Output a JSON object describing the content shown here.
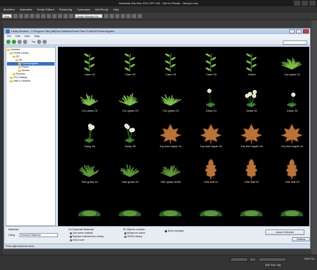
{
  "app": {
    "title": "Autodesk 3ds Max 2010 SP2 x64 - Not for Resale - library1.max",
    "menu": [
      "Modifiers",
      "Animation",
      "Graph Editors",
      "Rendering",
      "Customize",
      "MAXScript",
      "Help"
    ],
    "toolbar_select": "View",
    "named_selection": "Create Selection Se"
  },
  "library": {
    "title": "Library Browser - C:\\Program Files (x86)\\3rd Software\\Forest Pack Pro\\lib\\3D\\Flowers&grass",
    "menu": [
      "File",
      "Edit",
      "View",
      "Help"
    ],
    "toolbar_label": "Top",
    "tree": [
      {
        "label": "Libraries",
        "level": 0
      },
      {
        "label": "Forest Library",
        "level": 1
      },
      {
        "label": "3D",
        "level": 2
      },
      {
        "label": "3D",
        "level": 3
      },
      {
        "label": "Flowers&grass",
        "level": 4,
        "selected": true
      },
      {
        "label": "Plants",
        "level": 4
      },
      {
        "label": "Stones",
        "level": 4
      },
      {
        "label": "Pictures",
        "level": 2
      },
      {
        "label": "ITQ Catalog",
        "level": 1
      },
      {
        "label": "User's Libraries",
        "level": 1
      }
    ],
    "items": [
      {
        "label": "Cane 01",
        "kind": "cane"
      },
      {
        "label": "Cane 02",
        "kind": "cane"
      },
      {
        "label": "Cane 03",
        "kind": "cane"
      },
      {
        "label": "Cane 04",
        "kind": "cane"
      },
      {
        "label": "Canez",
        "kind": "cane"
      },
      {
        "label": "Cut grass 01",
        "kind": "grass"
      },
      {
        "label": "Cut grass 02",
        "kind": "grass"
      },
      {
        "label": "Cut grass 03",
        "kind": "grass"
      },
      {
        "label": "Cut grass 04",
        "kind": "grass"
      },
      {
        "label": "Daisy 01",
        "kind": "daisy"
      },
      {
        "label": "Daisy 02",
        "kind": "daisy"
      },
      {
        "label": "Daisy 03",
        "kind": "daisy"
      },
      {
        "label": "Daisy 04",
        "kind": "daisy"
      },
      {
        "label": "Daisy 05",
        "kind": "daisy"
      },
      {
        "label": "Dry leaf maple 01",
        "kind": "maple"
      },
      {
        "label": "Dry leaf maple 02",
        "kind": "maple"
      },
      {
        "label": "Dry leaf maple 03",
        "kind": "maple"
      },
      {
        "label": "Dry leaf maple 04",
        "kind": "maple"
      },
      {
        "label": "Hair grass 02",
        "kind": "hair"
      },
      {
        "label": "Hair grass 03",
        "kind": "hair"
      },
      {
        "label": "Hair grass white",
        "kind": "hair"
      },
      {
        "label": "Oak leaf 01",
        "kind": "oak"
      },
      {
        "label": "Oak leaf 02",
        "kind": "oak"
      },
      {
        "label": "Oak leaf 03",
        "kind": "oak"
      },
      {
        "label": "",
        "kind": "bottom"
      },
      {
        "label": "",
        "kind": "bottom"
      },
      {
        "label": "",
        "kind": "bottom"
      },
      {
        "label": "",
        "kind": "bottom"
      },
      {
        "label": "",
        "kind": "bottom"
      },
      {
        "label": "",
        "kind": "bottom"
      }
    ],
    "options": {
      "materials_label": "Materials",
      "using_label": "Using",
      "using_value": "Standard Materials",
      "duplicate_label": "On Duplicate Materials",
      "dup_options": [
        "Use scene material",
        "Replace material from Library",
        "Ask to user"
      ],
      "dup_selected": 1,
      "objects_label": "3D Objects creation",
      "obj_options": [
        "Merge into scene",
        "XRef to library"
      ],
      "obj_selected": 0,
      "show_warnings": "Show warnings",
      "import_button": "Import Selected",
      "options_button": "Options"
    },
    "status": "Press right button for menu"
  },
  "bottom": {
    "add_time_tag": "Add Time Tag",
    "auto_key": "Auto Key"
  }
}
